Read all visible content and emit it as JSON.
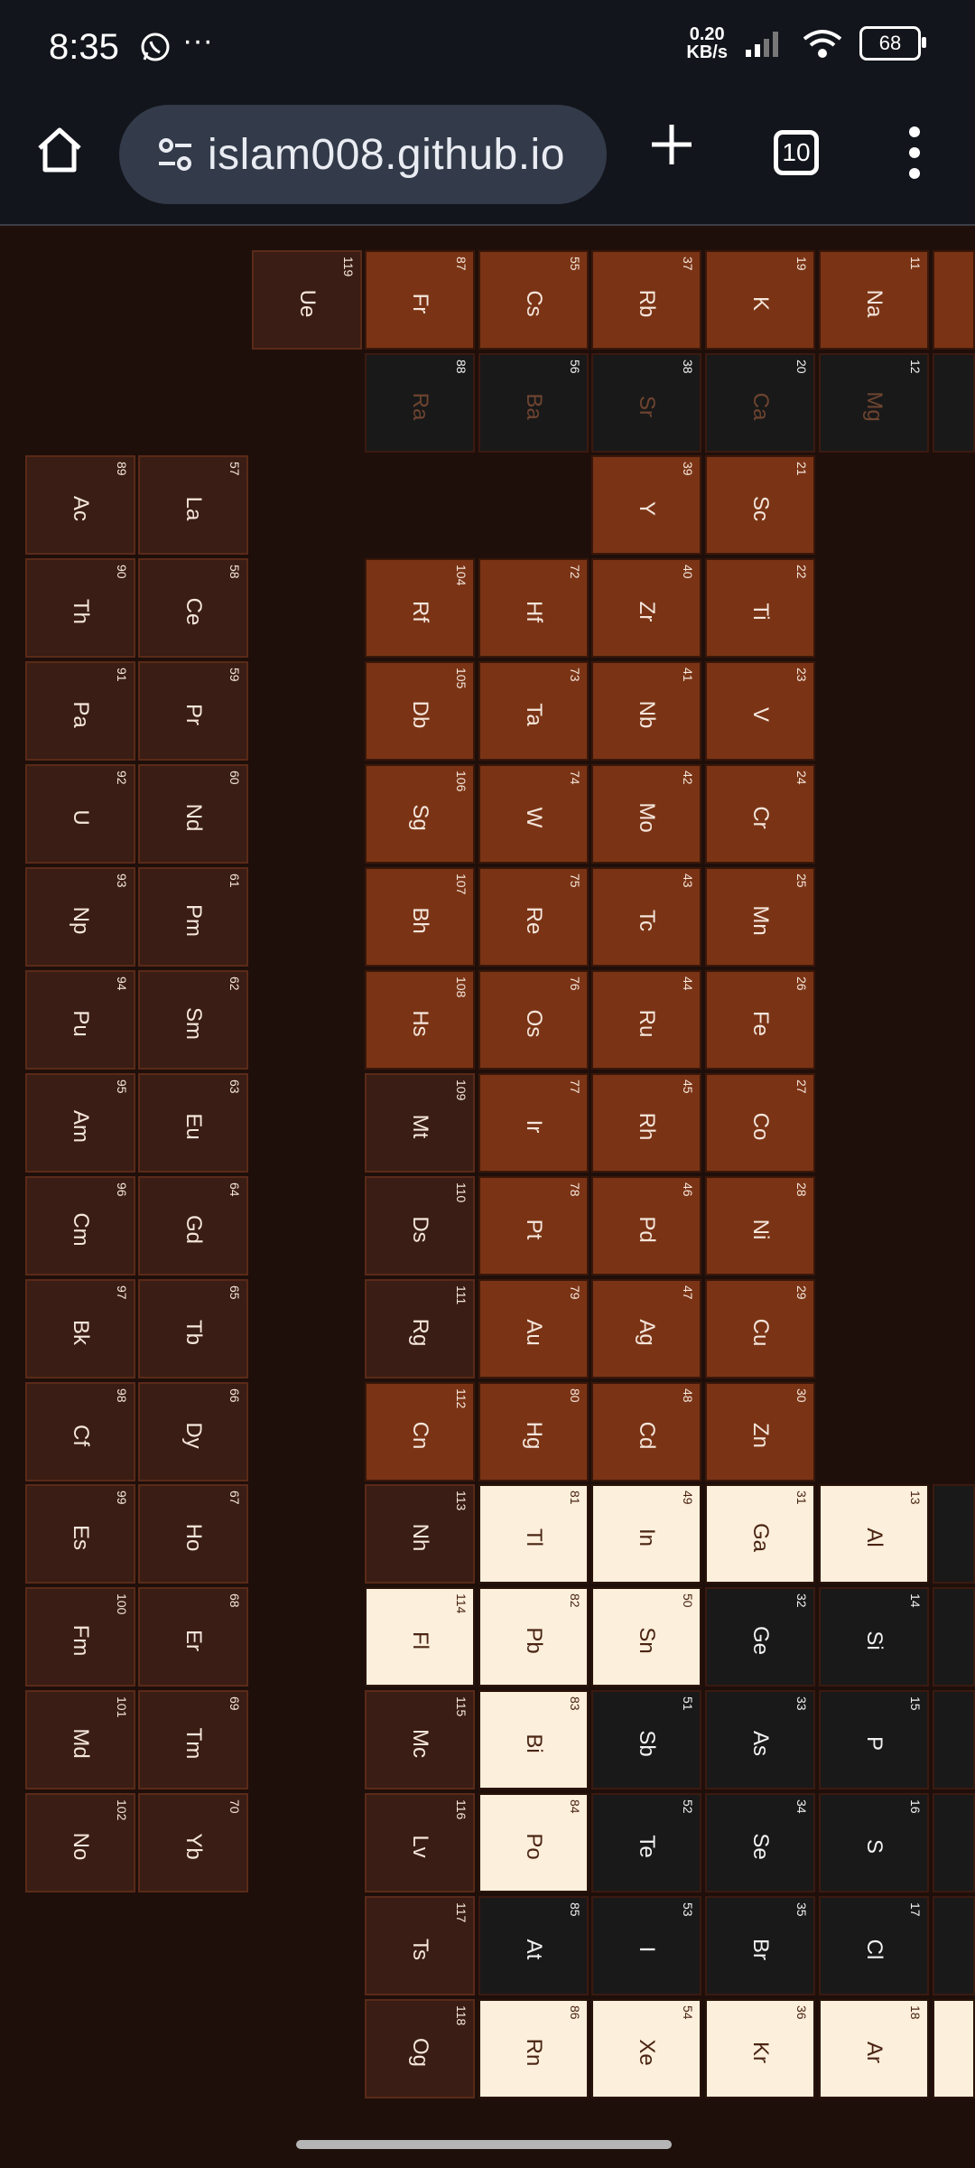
{
  "status": {
    "time": "8:35",
    "whatsapp_icon": "whatsapp-icon",
    "more": "···",
    "net_speed": "0.20",
    "net_unit": "KB/s",
    "battery": "68"
  },
  "browser": {
    "url": "islam008.github.io",
    "tab_count": "10"
  },
  "elements": [
    {
      "n": "119",
      "s": "Ue",
      "t": "dark"
    },
    {
      "n": "87",
      "s": "Fr",
      "t": "orange"
    },
    {
      "n": "55",
      "s": "Cs",
      "t": "orange"
    },
    {
      "n": "37",
      "s": "Rb",
      "t": "orange"
    },
    {
      "n": "19",
      "s": "K",
      "t": "orange"
    },
    {
      "n": "11",
      "s": "Na",
      "t": "orange"
    },
    {
      "n": "88",
      "s": "Ra",
      "t": "black"
    },
    {
      "n": "56",
      "s": "Ba",
      "t": "black"
    },
    {
      "n": "38",
      "s": "Sr",
      "t": "black"
    },
    {
      "n": "20",
      "s": "Ca",
      "t": "black"
    },
    {
      "n": "12",
      "s": "Mg",
      "t": "black"
    },
    {
      "n": "89",
      "s": "Ac",
      "t": "dark"
    },
    {
      "n": "57",
      "s": "La",
      "t": "dark"
    },
    {
      "n": "39",
      "s": "Y",
      "t": "orange"
    },
    {
      "n": "21",
      "s": "Sc",
      "t": "orange"
    },
    {
      "n": "90",
      "s": "Th",
      "t": "dark"
    },
    {
      "n": "58",
      "s": "Ce",
      "t": "dark"
    },
    {
      "n": "104",
      "s": "Rf",
      "t": "orange"
    },
    {
      "n": "72",
      "s": "Hf",
      "t": "orange"
    },
    {
      "n": "40",
      "s": "Zr",
      "t": "orange"
    },
    {
      "n": "22",
      "s": "Ti",
      "t": "orange"
    },
    {
      "n": "91",
      "s": "Pa",
      "t": "dark"
    },
    {
      "n": "59",
      "s": "Pr",
      "t": "dark"
    },
    {
      "n": "105",
      "s": "Db",
      "t": "orange"
    },
    {
      "n": "73",
      "s": "Ta",
      "t": "orange"
    },
    {
      "n": "41",
      "s": "Nb",
      "t": "orange"
    },
    {
      "n": "23",
      "s": "V",
      "t": "orange"
    },
    {
      "n": "92",
      "s": "U",
      "t": "dark"
    },
    {
      "n": "60",
      "s": "Nd",
      "t": "dark"
    },
    {
      "n": "106",
      "s": "Sg",
      "t": "orange"
    },
    {
      "n": "74",
      "s": "W",
      "t": "orange"
    },
    {
      "n": "42",
      "s": "Mo",
      "t": "orange"
    },
    {
      "n": "24",
      "s": "Cr",
      "t": "orange"
    },
    {
      "n": "93",
      "s": "Np",
      "t": "dark"
    },
    {
      "n": "61",
      "s": "Pm",
      "t": "dark"
    },
    {
      "n": "107",
      "s": "Bh",
      "t": "orange"
    },
    {
      "n": "75",
      "s": "Re",
      "t": "orange"
    },
    {
      "n": "43",
      "s": "Tc",
      "t": "orange"
    },
    {
      "n": "25",
      "s": "Mn",
      "t": "orange"
    },
    {
      "n": "94",
      "s": "Pu",
      "t": "dark"
    },
    {
      "n": "62",
      "s": "Sm",
      "t": "dark"
    },
    {
      "n": "108",
      "s": "Hs",
      "t": "orange"
    },
    {
      "n": "76",
      "s": "Os",
      "t": "orange"
    },
    {
      "n": "44",
      "s": "Ru",
      "t": "orange"
    },
    {
      "n": "26",
      "s": "Fe",
      "t": "orange"
    },
    {
      "n": "95",
      "s": "Am",
      "t": "dark"
    },
    {
      "n": "63",
      "s": "Eu",
      "t": "dark"
    },
    {
      "n": "109",
      "s": "Mt",
      "t": "dark"
    },
    {
      "n": "77",
      "s": "Ir",
      "t": "orange"
    },
    {
      "n": "45",
      "s": "Rh",
      "t": "orange"
    },
    {
      "n": "27",
      "s": "Co",
      "t": "orange"
    },
    {
      "n": "96",
      "s": "Cm",
      "t": "dark"
    },
    {
      "n": "64",
      "s": "Gd",
      "t": "dark"
    },
    {
      "n": "110",
      "s": "Ds",
      "t": "dark"
    },
    {
      "n": "78",
      "s": "Pt",
      "t": "orange"
    },
    {
      "n": "46",
      "s": "Pd",
      "t": "orange"
    },
    {
      "n": "28",
      "s": "Ni",
      "t": "orange"
    },
    {
      "n": "97",
      "s": "Bk",
      "t": "dark"
    },
    {
      "n": "65",
      "s": "Tb",
      "t": "dark"
    },
    {
      "n": "111",
      "s": "Rg",
      "t": "dark"
    },
    {
      "n": "79",
      "s": "Au",
      "t": "orange"
    },
    {
      "n": "47",
      "s": "Ag",
      "t": "orange"
    },
    {
      "n": "29",
      "s": "Cu",
      "t": "orange"
    },
    {
      "n": "98",
      "s": "Cf",
      "t": "dark"
    },
    {
      "n": "66",
      "s": "Dy",
      "t": "dark"
    },
    {
      "n": "112",
      "s": "Cn",
      "t": "orange"
    },
    {
      "n": "80",
      "s": "Hg",
      "t": "orange"
    },
    {
      "n": "48",
      "s": "Cd",
      "t": "orange"
    },
    {
      "n": "30",
      "s": "Zn",
      "t": "orange"
    },
    {
      "n": "99",
      "s": "Es",
      "t": "dark"
    },
    {
      "n": "67",
      "s": "Ho",
      "t": "dark"
    },
    {
      "n": "113",
      "s": "Nh",
      "t": "dark"
    },
    {
      "n": "81",
      "s": "Tl",
      "t": "cream"
    },
    {
      "n": "49",
      "s": "In",
      "t": "cream"
    },
    {
      "n": "31",
      "s": "Ga",
      "t": "cream"
    },
    {
      "n": "13",
      "s": "Al",
      "t": "cream"
    },
    {
      "n": "100",
      "s": "Fm",
      "t": "dark"
    },
    {
      "n": "68",
      "s": "Er",
      "t": "dark"
    },
    {
      "n": "114",
      "s": "Fl",
      "t": "cream"
    },
    {
      "n": "82",
      "s": "Pb",
      "t": "cream"
    },
    {
      "n": "50",
      "s": "Sn",
      "t": "cream"
    },
    {
      "n": "32",
      "s": "Ge",
      "t": "black"
    },
    {
      "n": "14",
      "s": "Si",
      "t": "black"
    },
    {
      "n": "101",
      "s": "Md",
      "t": "dark"
    },
    {
      "n": "69",
      "s": "Tm",
      "t": "dark"
    },
    {
      "n": "115",
      "s": "Mc",
      "t": "dark"
    },
    {
      "n": "83",
      "s": "Bi",
      "t": "cream"
    },
    {
      "n": "51",
      "s": "Sb",
      "t": "black"
    },
    {
      "n": "33",
      "s": "As",
      "t": "black"
    },
    {
      "n": "15",
      "s": "P",
      "t": "black"
    },
    {
      "n": "102",
      "s": "No",
      "t": "dark"
    },
    {
      "n": "70",
      "s": "Yb",
      "t": "dark"
    },
    {
      "n": "116",
      "s": "Lv",
      "t": "dark"
    },
    {
      "n": "84",
      "s": "Po",
      "t": "cream"
    },
    {
      "n": "52",
      "s": "Te",
      "t": "black"
    },
    {
      "n": "34",
      "s": "Se",
      "t": "black"
    },
    {
      "n": "16",
      "s": "S",
      "t": "black"
    },
    {
      "n": "117",
      "s": "Ts",
      "t": "dark"
    },
    {
      "n": "85",
      "s": "At",
      "t": "black"
    },
    {
      "n": "53",
      "s": "I",
      "t": "black"
    },
    {
      "n": "35",
      "s": "Br",
      "t": "black"
    },
    {
      "n": "17",
      "s": "Cl",
      "t": "black"
    },
    {
      "n": "118",
      "s": "Og",
      "t": "dark"
    },
    {
      "n": "86",
      "s": "Rn",
      "t": "cream"
    },
    {
      "n": "54",
      "s": "Xe",
      "t": "cream"
    },
    {
      "n": "36",
      "s": "Kr",
      "t": "cream"
    },
    {
      "n": "18",
      "s": "Ar",
      "t": "cream"
    }
  ]
}
